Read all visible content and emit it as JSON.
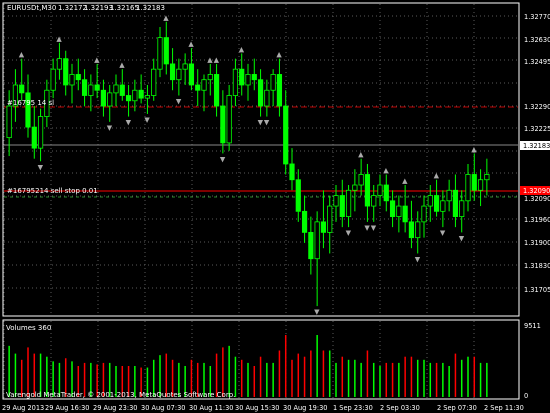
{
  "chart_header": {
    "symbol": "EURUSDt,M30",
    "open": "1.32172",
    "high": "1.32193",
    "low": "1.32165",
    "close": "1.32183"
  },
  "orders": {
    "upper_label": "#16795 14 sl",
    "lower_label": "#16795214 sell stop 0.01"
  },
  "price_axis": {
    "labels": [
      "1.32770",
      "1.32630",
      "1.32495",
      "1.32290",
      "1.32225",
      "1.32183",
      "1.32090",
      "1.31960",
      "1.31900",
      "1.31830",
      "1.31705"
    ],
    "current_price": "1.32183",
    "sell_stop_price": "1.32090"
  },
  "volumes": {
    "title": "Volumes 360",
    "max_label": "9511",
    "zero_label": "0"
  },
  "time_axis": {
    "labels": [
      "29 Aug 2013",
      "29 Aug 16:30",
      "29 Aug 23:30",
      "30 Aug 07:30",
      "30 Aug 11:30",
      "30 Aug 15:30",
      "30 Aug 19:30",
      "1 Sep 23:30",
      "2 Sep 03:30",
      "2 Sep 07:30",
      "2 Sep 11:30"
    ]
  },
  "copyright": "Varengold MetaTrader, © 2001-2013, MetaQuotes Software Corp.",
  "colors": {
    "background": "#000000",
    "bull": "#00ff00",
    "bear": "#00ff00",
    "grid": "#5a5a5a",
    "order_line": "#c00000",
    "sell_stop_line": "#ff0000",
    "current_line": "#888888",
    "volume_red": "#ff0000",
    "volume_green": "#00ff00"
  },
  "chart_data": {
    "type": "candlestick",
    "title": "EURUSDt,M30",
    "ylim": [
      1.3165,
      1.3282
    ],
    "candles": [
      [
        1.3232,
        1.325,
        1.3225,
        1.3244
      ],
      [
        1.3244,
        1.3258,
        1.3238,
        1.3252
      ],
      [
        1.3252,
        1.3262,
        1.3246,
        1.3249
      ],
      [
        1.3249,
        1.3256,
        1.3232,
        1.3236
      ],
      [
        1.3236,
        1.3244,
        1.3224,
        1.3228
      ],
      [
        1.3228,
        1.3243,
        1.3223,
        1.324
      ],
      [
        1.324,
        1.3254,
        1.3236,
        1.325
      ],
      [
        1.325,
        1.3262,
        1.3247,
        1.3258
      ],
      [
        1.3258,
        1.3268,
        1.3254,
        1.3262
      ],
      [
        1.3262,
        1.3265,
        1.3248,
        1.3252
      ],
      [
        1.3252,
        1.326,
        1.3245,
        1.3256
      ],
      [
        1.3256,
        1.3262,
        1.325,
        1.3254
      ],
      [
        1.3254,
        1.3258,
        1.3244,
        1.3248
      ],
      [
        1.3248,
        1.3256,
        1.3242,
        1.3252
      ],
      [
        1.3252,
        1.326,
        1.3247,
        1.325
      ],
      [
        1.325,
        1.3254,
        1.324,
        1.3244
      ],
      [
        1.3244,
        1.3252,
        1.3238,
        1.3249
      ],
      [
        1.3249,
        1.3256,
        1.3244,
        1.3252
      ],
      [
        1.3252,
        1.3258,
        1.3246,
        1.3248
      ],
      [
        1.3248,
        1.3252,
        1.324,
        1.3246
      ],
      [
        1.3246,
        1.3254,
        1.3242,
        1.325
      ],
      [
        1.325,
        1.3256,
        1.3245,
        1.3247
      ],
      [
        1.3247,
        1.3252,
        1.3241,
        1.3248
      ],
      [
        1.3248,
        1.3262,
        1.3246,
        1.3258
      ],
      [
        1.3258,
        1.3274,
        1.3255,
        1.327
      ],
      [
        1.327,
        1.3276,
        1.3256,
        1.326
      ],
      [
        1.326,
        1.3266,
        1.325,
        1.3254
      ],
      [
        1.3254,
        1.3262,
        1.3248,
        1.3258
      ],
      [
        1.3258,
        1.3264,
        1.3252,
        1.326
      ],
      [
        1.326,
        1.3266,
        1.325,
        1.3252
      ],
      [
        1.3252,
        1.3258,
        1.3244,
        1.325
      ],
      [
        1.325,
        1.3256,
        1.3242,
        1.3254
      ],
      [
        1.3254,
        1.326,
        1.3248,
        1.3256
      ],
      [
        1.3256,
        1.326,
        1.324,
        1.3244
      ],
      [
        1.3244,
        1.325,
        1.3226,
        1.323
      ],
      [
        1.323,
        1.3252,
        1.3227,
        1.3248
      ],
      [
        1.3248,
        1.3262,
        1.3244,
        1.3258
      ],
      [
        1.3258,
        1.3264,
        1.3248,
        1.3252
      ],
      [
        1.3252,
        1.326,
        1.3246,
        1.3256
      ],
      [
        1.3256,
        1.3262,
        1.325,
        1.3254
      ],
      [
        1.3254,
        1.3258,
        1.324,
        1.3244
      ],
      [
        1.3244,
        1.3254,
        1.324,
        1.325
      ],
      [
        1.325,
        1.3258,
        1.3244,
        1.3256
      ],
      [
        1.3256,
        1.3262,
        1.324,
        1.3244
      ],
      [
        1.3244,
        1.325,
        1.3218,
        1.3222
      ],
      [
        1.3222,
        1.3228,
        1.3212,
        1.3216
      ],
      [
        1.3216,
        1.322,
        1.32,
        1.3204
      ],
      [
        1.3204,
        1.321,
        1.3192,
        1.3196
      ],
      [
        1.3196,
        1.3202,
        1.318,
        1.3186
      ],
      [
        1.3186,
        1.3204,
        1.3168,
        1.32
      ],
      [
        1.32,
        1.3212,
        1.319,
        1.3196
      ],
      [
        1.3196,
        1.321,
        1.3188,
        1.3206
      ],
      [
        1.3206,
        1.3214,
        1.32,
        1.321
      ],
      [
        1.321,
        1.3216,
        1.3198,
        1.3202
      ],
      [
        1.3202,
        1.3214,
        1.3198,
        1.3212
      ],
      [
        1.3212,
        1.322,
        1.3204,
        1.3214
      ],
      [
        1.3214,
        1.3224,
        1.321,
        1.3218
      ],
      [
        1.3218,
        1.3222,
        1.32,
        1.3206
      ],
      [
        1.3206,
        1.3214,
        1.32,
        1.321
      ],
      [
        1.321,
        1.3218,
        1.3206,
        1.3214
      ],
      [
        1.3214,
        1.3218,
        1.3204,
        1.3208
      ],
      [
        1.3208,
        1.3212,
        1.3198,
        1.3202
      ],
      [
        1.3202,
        1.321,
        1.3196,
        1.3206
      ],
      [
        1.3206,
        1.3214,
        1.3196,
        1.32
      ],
      [
        1.32,
        1.3208,
        1.319,
        1.3194
      ],
      [
        1.3194,
        1.3204,
        1.3188,
        1.32
      ],
      [
        1.32,
        1.321,
        1.3194,
        1.3206
      ],
      [
        1.3206,
        1.3214,
        1.32,
        1.321
      ],
      [
        1.321,
        1.3216,
        1.3202,
        1.3204
      ],
      [
        1.3204,
        1.3212,
        1.3198,
        1.3208
      ],
      [
        1.3208,
        1.3216,
        1.3204,
        1.3212
      ],
      [
        1.3212,
        1.3218,
        1.3198,
        1.3202
      ],
      [
        1.3202,
        1.3212,
        1.3196,
        1.3208
      ],
      [
        1.3208,
        1.3222,
        1.3204,
        1.3218
      ],
      [
        1.3218,
        1.3226,
        1.3208,
        1.3212
      ],
      [
        1.3212,
        1.322,
        1.3206,
        1.3216
      ],
      [
        1.3216,
        1.3224,
        1.321,
        1.3218
      ]
    ]
  }
}
